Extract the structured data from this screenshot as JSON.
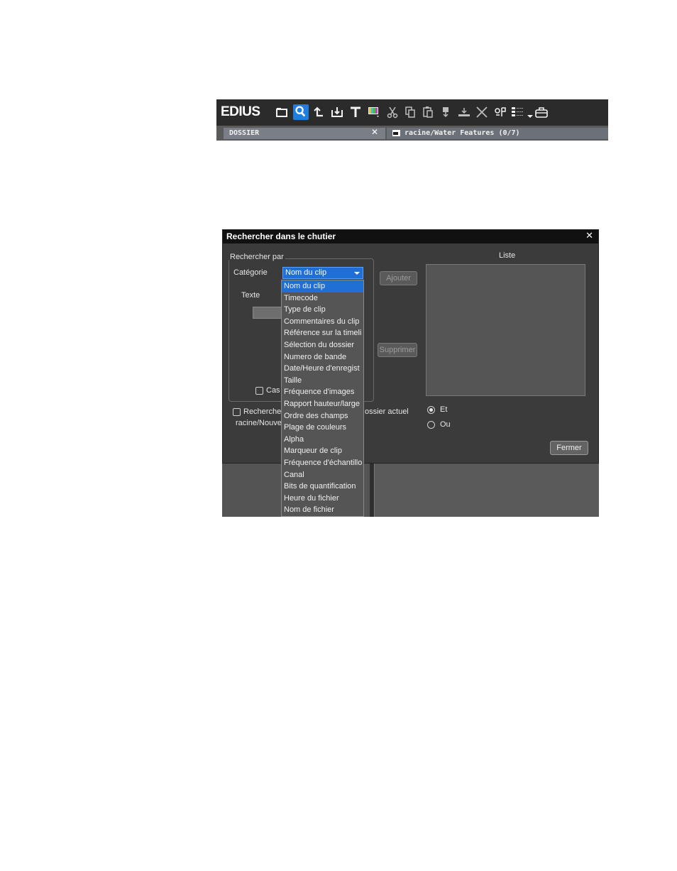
{
  "toolbar": {
    "brand": "EDIUS",
    "icons": [
      "new-folder-icon",
      "search-icon",
      "up-icon",
      "import-icon",
      "title-icon",
      "color-bars-icon",
      "cut-icon",
      "copy-icon",
      "paste-icon",
      "add-to-timeline-icon",
      "insert-icon",
      "delete-icon",
      "properties-icon",
      "view-icon",
      "briefcase-icon"
    ],
    "folder_tab_label": "DOSSIER",
    "path_label": "racine/Water Features (0/7)"
  },
  "dialog": {
    "title": "Rechercher dans le chutier",
    "group_label": "Rechercher par",
    "category_label": "Catégorie",
    "category_value": "Nom du clip",
    "text_label": "Texte",
    "case_label": "Cas",
    "list_label": "Liste",
    "add_button": "Ajouter",
    "delete_button": "Supprimer",
    "search_folder_label": "Recherche",
    "search_folder_suffix": "ossier actuel",
    "folder_path": "racine/Nouve",
    "radio_and": "Et",
    "radio_or": "Ou",
    "close_button": "Fermer",
    "dropdown_options": [
      "Nom du clip",
      "Timecode",
      "Type de clip",
      "Commentaires du clip",
      "Référence sur la timeli",
      "Sélection du dossier",
      "Numero de bande",
      "Date/Heure d'enregist",
      "Taille",
      "Fréquence d'images",
      "Rapport hauteur/large",
      "Ordre des champs",
      "Plage de couleurs",
      "Alpha",
      "Marqueur de clip",
      "Fréquence d'échantillo",
      "Canal",
      "Bits de quantification",
      "Heure du fichier",
      "Nom de fichier"
    ],
    "selected_option_index": 0
  },
  "colors": {
    "accent": "#1f6fd6",
    "dialog_bg": "#3b3b3b",
    "title_bar": "#111111"
  }
}
